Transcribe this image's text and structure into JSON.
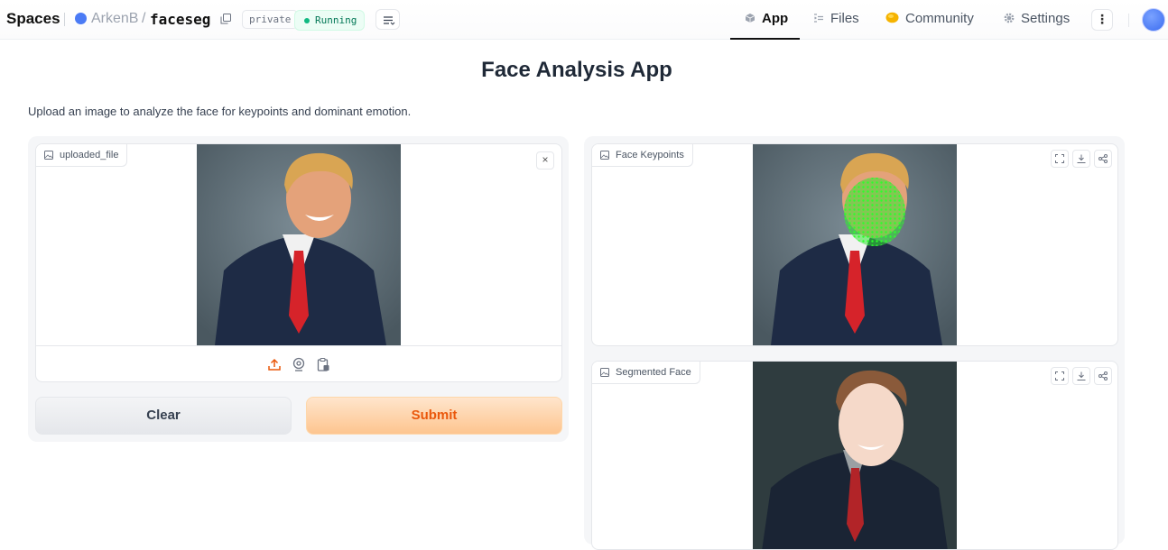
{
  "header": {
    "brand": "Spaces",
    "owner": "ArkenB",
    "separator": "/",
    "repo": "faceseg",
    "visibility": "private",
    "status": "Running",
    "nav": {
      "app": "App",
      "files": "Files",
      "community": "Community",
      "settings": "Settings"
    },
    "more": "⋮"
  },
  "main": {
    "title": "Face Analysis App",
    "description": "Upload an image to analyze the face for keypoints and dominant emotion.",
    "input": {
      "label": "uploaded_file",
      "close": "×"
    },
    "outputs": {
      "keypoints_label": "Face Keypoints",
      "segmented_label": "Segmented Face"
    },
    "buttons": {
      "clear": "Clear",
      "submit": "Submit"
    }
  },
  "colors": {
    "accent": "#ea580c",
    "running": "#10b981",
    "owner_avatar": "#4b7bf5"
  }
}
